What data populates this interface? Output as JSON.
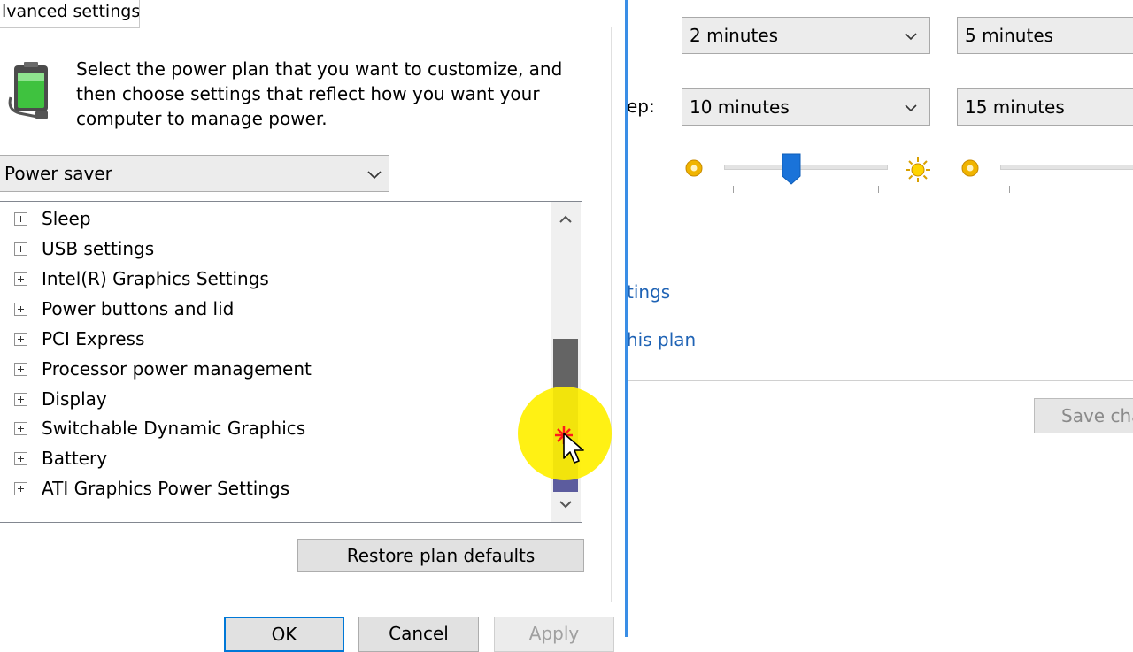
{
  "dialog": {
    "title": "lvanced settings",
    "intro": "Select the power plan that you want to customize, and then choose settings that reflect how you want your computer to manage power.",
    "plan_selected": "Power saver",
    "tree_items": [
      "Sleep",
      "USB settings",
      "Intel(R) Graphics Settings",
      "Power buttons and lid",
      "PCI Express",
      "Processor power management",
      "Display",
      "Switchable Dynamic Graphics",
      "Battery",
      "ATI Graphics Power Settings"
    ],
    "restore_label": "Restore plan defaults",
    "ok_label": "OK",
    "cancel_label": "Cancel",
    "apply_label": "Apply"
  },
  "background": {
    "row1": {
      "on_battery": "2 minutes",
      "plugged_in": "5 minutes"
    },
    "row2": {
      "label": "ep:",
      "on_battery": "10 minutes",
      "plugged_in": "15 minutes"
    },
    "link1": "tings",
    "link2": "his plan",
    "save_label": "Save cha"
  },
  "colors": {
    "accent": "#0078d7",
    "link": "#1f63b5",
    "slider_thumb": "#1a73d9",
    "scroll_thumb": "#5c5c9e",
    "cursor_highlight": "#fff000"
  },
  "icons": [
    "battery-power-icon",
    "chevron-down-icon",
    "expand-plus-icon",
    "scroll-up-arrow-icon",
    "scroll-down-arrow-icon",
    "brightness-low-icon",
    "brightness-high-icon",
    "mouse-pointer-icon"
  ]
}
